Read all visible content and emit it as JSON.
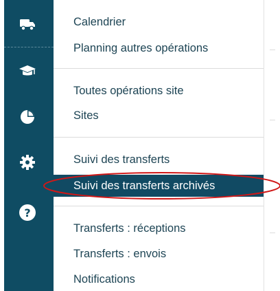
{
  "sidebar": {
    "icons": [
      "truck-icon",
      "graduation-cap-icon",
      "pie-chart-icon",
      "gear-icon",
      "help-icon"
    ]
  },
  "menu": {
    "group1": [
      "Calendrier",
      "Planning autres opérations"
    ],
    "group2": [
      "Toutes opérations site",
      "Sites"
    ],
    "group3_item": "Suivi des transferts",
    "active_item": "Suivi des transferts archivés",
    "group4": [
      "Transferts : réceptions",
      "Transferts : envois",
      "Notifications"
    ]
  },
  "colors": {
    "sidebar_bg": "#0f4c63",
    "active_bg": "#114a63",
    "menu_text": "#1d4454",
    "highlight_ring": "#d01818"
  }
}
